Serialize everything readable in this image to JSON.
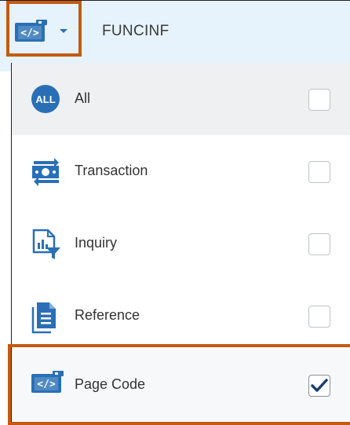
{
  "header": {
    "title": "FUNCINF",
    "type_icon": "page-code-icon",
    "dropdown_icon": "caret-down-icon"
  },
  "filters": [
    {
      "label": "All",
      "icon": "all-badge-icon",
      "checked": false
    },
    {
      "label": "Transaction",
      "icon": "transaction-icon",
      "checked": false
    },
    {
      "label": "Inquiry",
      "icon": "inquiry-report-icon",
      "checked": false
    },
    {
      "label": "Reference",
      "icon": "reference-document-icon",
      "checked": false
    },
    {
      "label": "Page Code",
      "icon": "page-code-icon",
      "checked": true
    }
  ],
  "all_badge_text": "ALL",
  "colors": {
    "accent_blue": "#2a6fb6",
    "header_bg": "#e6f3fc",
    "highlight": "#c45a12",
    "check": "#1d3f6e"
  }
}
